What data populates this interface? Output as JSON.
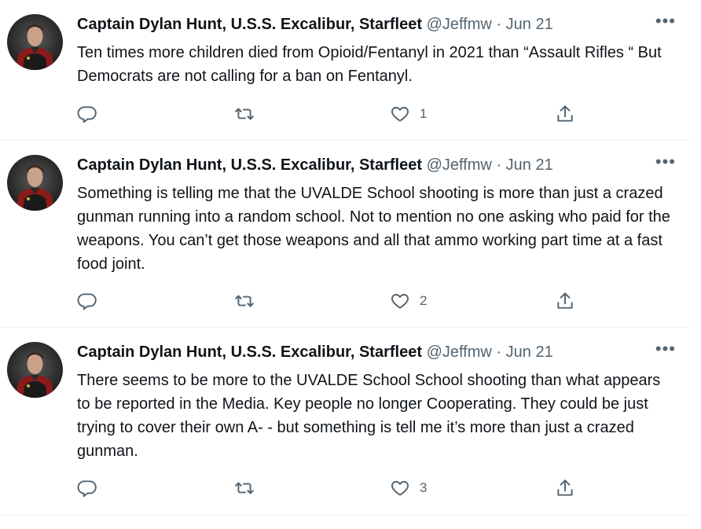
{
  "tweets": [
    {
      "name": "Captain Dylan Hunt, U.S.S. Excalibur, Starfleet",
      "handle": "@Jeffmw",
      "dot": "·",
      "date": "Jun 21",
      "more": "•••",
      "text": "Ten times more children died from Opioid/Fentanyl  in 2021 than “Assault Rifles “ But Democrats are not calling for a ban on Fentanyl.",
      "likes": "1"
    },
    {
      "name": "Captain Dylan Hunt, U.S.S. Excalibur, Starfleet",
      "handle": "@Jeffmw",
      "dot": "·",
      "date": "Jun 21",
      "more": "•••",
      "text": "Something is telling me that the UVALDE School shooting is more than just a crazed gunman running into a random school. Not to mention no one asking who paid for the weapons. You can’t get those weapons and all that ammo working part time at a fast food joint.",
      "likes": "2"
    },
    {
      "name": "Captain Dylan Hunt, U.S.S. Excalibur, Starfleet",
      "handle": "@Jeffmw",
      "dot": "·",
      "date": "Jun 21",
      "more": "•••",
      "text": "There seems to be more to the UVALDE School School shooting than what appears to be reported in the Media. Key people no longer Cooperating. They could be just trying to cover their own A- - but something is tell me it’s more than just a crazed gunman.",
      "likes": "3"
    }
  ],
  "icons": {
    "reply": "reply-icon",
    "retweet": "retweet-icon",
    "like": "heart-icon",
    "share": "share-icon"
  },
  "colors": {
    "text": "#0f1419",
    "secondary": "#536471",
    "border": "#eff3f4",
    "uniform_red": "#8b1a1a"
  }
}
